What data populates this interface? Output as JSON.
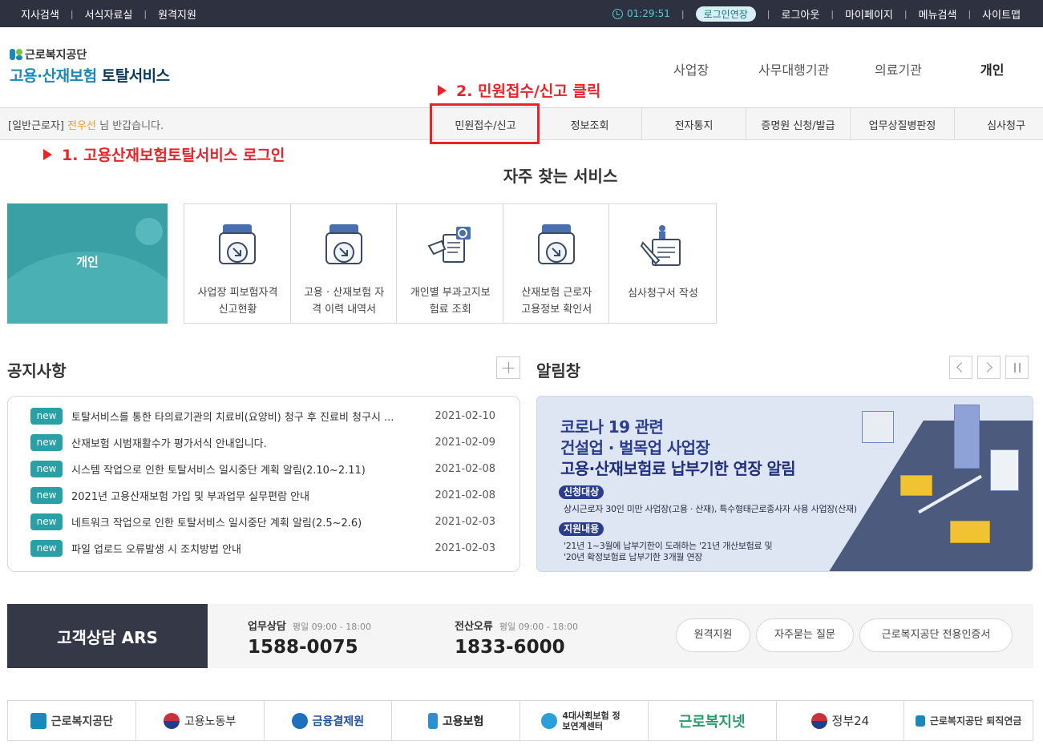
{
  "topbar": {
    "left_links": [
      "지사검색",
      "서식자료실",
      "원격지원"
    ],
    "timer": "01:29:51",
    "extend_label": "로그인연장",
    "right_links": [
      "로그아웃",
      "마이페이지",
      "메뉴검색",
      "사이트맵"
    ]
  },
  "header": {
    "logo_top": "근로복지공단",
    "logo_blue": "고용·산재보험",
    "logo_dark": "토탈서비스",
    "gnb": [
      "사업장",
      "사무대행기관",
      "의료기관",
      "개인"
    ],
    "gnb_active": "개인"
  },
  "subnav": {
    "user_type": "[일반근로자]",
    "user_name": "전우선",
    "greeting": "님 반갑습니다.",
    "menu": [
      "민원접수/신고",
      "정보조회",
      "전자통지",
      "증명원 신청/발급",
      "업무상질병판정",
      "심사청구"
    ]
  },
  "annotations": {
    "step1": "1. 고용산재보험토탈서비스 로그인",
    "step2": "2. 민원접수/신고 클릭"
  },
  "services": {
    "title": "자주 찾는 서비스",
    "banner_label": "개인",
    "items": [
      {
        "line1": "사업장 피보험자격",
        "line2": "신고현황",
        "icon": "document-arrow-icon"
      },
      {
        "line1": "고용 · 산재보험 자",
        "line2": "격 이력 내역서",
        "icon": "document-arrow-icon"
      },
      {
        "line1": "개인별 부과고지보",
        "line2": "험료 조회",
        "icon": "document-search-icon"
      },
      {
        "line1": "산재보험 근로자",
        "line2": "고용정보 확인서",
        "icon": "document-arrow-icon"
      },
      {
        "line1": "심사청구서 작성",
        "line2": "",
        "icon": "document-pen-icon"
      }
    ]
  },
  "notice": {
    "title": "공지사항",
    "badge": "new",
    "items": [
      {
        "title": "토탈서비스를 통한 타의료기관의 치료비(요양비) 청구 후 진료비 청구시 ...",
        "date": "2021-02-10"
      },
      {
        "title": "산재보험 시범재활수가 평가서식 안내입니다.",
        "date": "2021-02-09"
      },
      {
        "title": "시스템 작업으로 인한 토탈서비스 일시중단 계획 알림(2.10~2.11)",
        "date": "2021-02-08"
      },
      {
        "title": "2021년 고용산재보험 가입 및 부과업무 실무편람 안내",
        "date": "2021-02-08"
      },
      {
        "title": "네트워크 작업으로 인한 토탈서비스 일시중단 계획 알림(2.5~2.6)",
        "date": "2021-02-03"
      },
      {
        "title": "파일 업로드 오류발생 시 조치방법 안내",
        "date": "2021-02-03"
      }
    ]
  },
  "alert": {
    "title": "알림창",
    "banner": {
      "line1": "코로나 19 관련",
      "line2": "건설업 · 벌목업 사업장",
      "line3": "고용·산재보험료 납부기한 연장 알림",
      "pill1": "신청대상",
      "text1": "상시근로자 30인 미만 사업장(고용 · 산재), 특수형태근로종사자 사용 사업장(산재)",
      "pill2": "지원내용",
      "text2": "'21년 1~3월에 납부기한이 도래하는 '21년 개산보험료 및",
      "text3": "'20년 확정보험료 납부기한 3개월 연장"
    }
  },
  "customer": {
    "title": "고객상담 ARS",
    "work_label": "업무상담",
    "work_hours": "평일 09:00 - 18:00",
    "work_number": "1588-0075",
    "err_label": "전산오류",
    "err_hours": "평일 09:00 - 18:00",
    "err_number": "1833-6000",
    "buttons": [
      "원격지원",
      "자주묻는 질문",
      "근로복지공단 전용인증서"
    ]
  },
  "partners": [
    "근로복지공단",
    "고용노동부",
    "금융결제원",
    "고용보험",
    "4대사회보험 정보연계센터",
    "근로복지넷",
    "정부24",
    "근로복지공단 퇴직연금"
  ]
}
